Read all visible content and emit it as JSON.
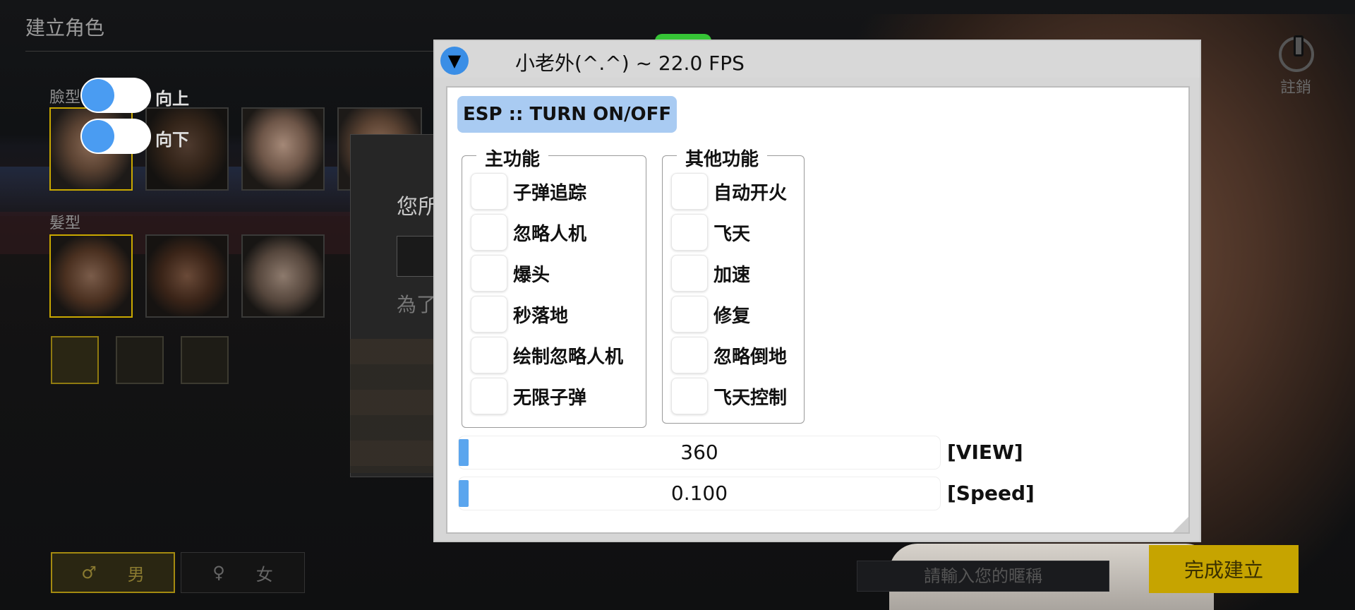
{
  "game": {
    "page_title": "建立角色",
    "face_label": "臉型",
    "hair_label": "髮型",
    "dialog_text1": "您所",
    "dialog_text2": "為了",
    "logout_label": "註銷",
    "gender_male_symbol": "♂",
    "gender_male": "男",
    "gender_female_symbol": "♀",
    "gender_female": "女",
    "nickname_placeholder": "請輸入您的暱稱",
    "complete_button": "完成建立"
  },
  "toggles": [
    {
      "label": "向上",
      "state": "on"
    },
    {
      "label": "向下",
      "state": "on"
    }
  ],
  "menu": {
    "title": "小老外(^.^) ~ 22.0 FPS",
    "collapse_icon": "▼",
    "esp_button": "ESP :: TURN ON/OFF",
    "main_group": {
      "title": "主功能",
      "items": [
        "子弹追踪",
        "忽略人机",
        "爆头",
        "秒落地",
        "绘制忽略人机",
        "无限子弹"
      ]
    },
    "other_group": {
      "title": "其他功能",
      "items": [
        "自动开火",
        "飞天",
        "加速",
        "修复",
        "忽略倒地",
        "飞天控制"
      ]
    },
    "sliders": [
      {
        "value": "360",
        "label": "[VIEW]"
      },
      {
        "value": "0.100",
        "label": "[Speed]"
      }
    ],
    "colors": {
      "accent": "#4a9cf2",
      "esp_button_bg": "#a9cbf2",
      "slider_fill": "#5aa5ee"
    }
  }
}
